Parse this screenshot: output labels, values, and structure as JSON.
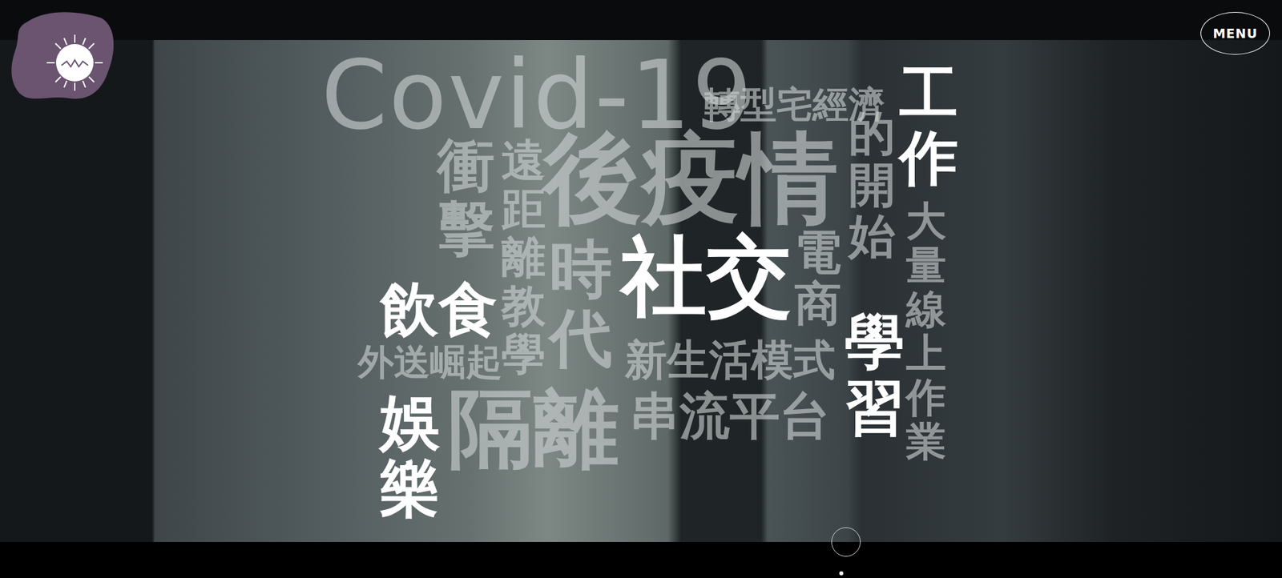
{
  "header": {
    "menu": "MENU"
  },
  "word_cloud": [
    {
      "text": "Covid-19",
      "highlighted": false,
      "kind": "horizontal"
    },
    {
      "text": "轉型宅經濟",
      "highlighted": false,
      "kind": "horizontal"
    },
    {
      "text": "工作",
      "highlighted": true,
      "kind": "vertical"
    },
    {
      "text": "後疫情",
      "highlighted": false,
      "kind": "horizontal"
    },
    {
      "text": "的開始",
      "highlighted": false,
      "kind": "vertical"
    },
    {
      "text": "衝擊",
      "highlighted": false,
      "kind": "vertical"
    },
    {
      "text": "遠距離教學",
      "highlighted": false,
      "kind": "vertical"
    },
    {
      "text": "時代",
      "highlighted": false,
      "kind": "vertical"
    },
    {
      "text": "社交",
      "highlighted": true,
      "kind": "horizontal"
    },
    {
      "text": "電商",
      "highlighted": false,
      "kind": "vertical"
    },
    {
      "text": "大量線上作業",
      "highlighted": false,
      "kind": "vertical"
    },
    {
      "text": "學習",
      "highlighted": true,
      "kind": "vertical"
    },
    {
      "text": "飲食",
      "highlighted": true,
      "kind": "horizontal"
    },
    {
      "text": "外送崛起",
      "highlighted": false,
      "kind": "horizontal"
    },
    {
      "text": "新生活模式",
      "highlighted": false,
      "kind": "horizontal"
    },
    {
      "text": "隔離",
      "highlighted": false,
      "kind": "horizontal"
    },
    {
      "text": "串流平台",
      "highlighted": false,
      "kind": "horizontal"
    },
    {
      "text": "娛樂",
      "highlighted": true,
      "kind": "vertical"
    }
  ],
  "pager": [
    {
      "selected": true
    }
  ]
}
